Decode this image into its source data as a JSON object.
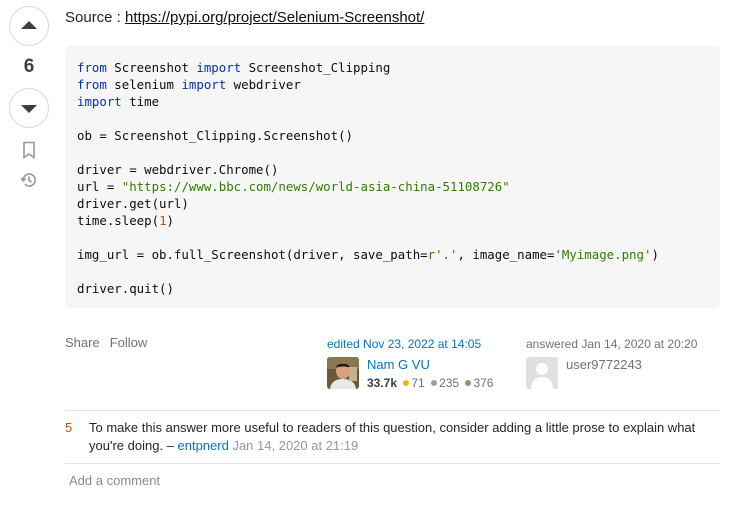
{
  "vote": {
    "score": "6"
  },
  "source": {
    "label": "Source : ",
    "url": "https://pypi.org/project/Selenium-Screenshot/"
  },
  "code": {
    "lines": [
      [
        {
          "t": "from",
          "c": "kw"
        },
        {
          "t": " Screenshot "
        },
        {
          "t": "import",
          "c": "kw"
        },
        {
          "t": " Screenshot_Clipping"
        }
      ],
      [
        {
          "t": "from",
          "c": "kw"
        },
        {
          "t": " selenium "
        },
        {
          "t": "import",
          "c": "kw"
        },
        {
          "t": " webdriver"
        }
      ],
      [
        {
          "t": "import",
          "c": "kw"
        },
        {
          "t": " time"
        }
      ],
      [],
      [
        {
          "t": "ob = Screenshot_Clipping.Screenshot()"
        }
      ],
      [],
      [
        {
          "t": "driver = webdriver.Chrome()"
        }
      ],
      [
        {
          "t": "url = "
        },
        {
          "t": "\"https://www.bbc.com/news/world-asia-china-51108726\"",
          "c": "str"
        }
      ],
      [
        {
          "t": "driver.get(url)"
        }
      ],
      [
        {
          "t": "time.sleep("
        },
        {
          "t": "1",
          "c": "num"
        },
        {
          "t": ")"
        }
      ],
      [],
      [
        {
          "t": "img_url = ob.full_Screenshot(driver, save_path="
        },
        {
          "t": "r'.'",
          "c": "str"
        },
        {
          "t": ", image_name="
        },
        {
          "t": "'Myimage.png'",
          "c": "str"
        },
        {
          "t": ")"
        }
      ],
      [],
      [
        {
          "t": "driver.quit()"
        }
      ]
    ]
  },
  "menu": {
    "share": "Share",
    "follow": "Follow"
  },
  "edited": {
    "label": "edited Nov 23, 2022 at 14:05",
    "user": "Nam G VU",
    "reputation": "33.7k",
    "gold": "71",
    "silver": "235",
    "bronze": "376"
  },
  "answered": {
    "label": "answered Jan 14, 2020 at 20:20",
    "user": "user9772243"
  },
  "comments": [
    {
      "score": "5",
      "text": "To make this answer more useful to readers of this question, consider adding a little prose to explain what you're doing. –",
      "user": "entpnerd",
      "date": "Jan 14, 2020 at 21:19"
    }
  ],
  "add_comment": "Add a comment",
  "colors": {
    "link": "#0074cc",
    "code_bg": "#f6f6f6",
    "keyword": "#0033b3",
    "string": "#2f7d00",
    "number": "#b75301"
  }
}
